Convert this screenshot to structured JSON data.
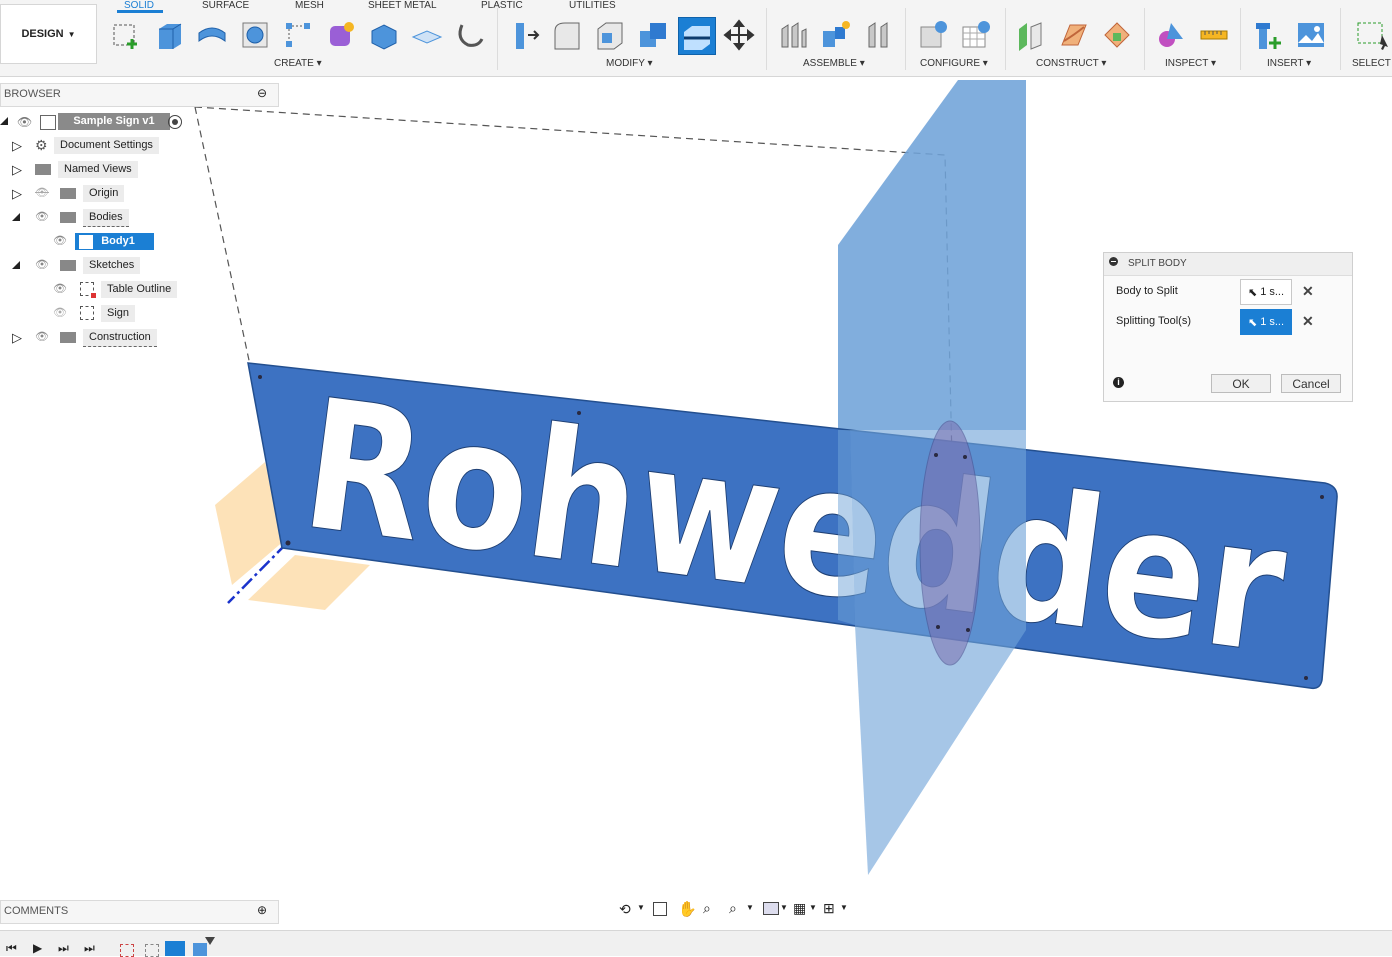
{
  "toolbar": {
    "workspace": "DESIGN",
    "tabs": [
      "SOLID",
      "SURFACE",
      "MESH",
      "SHEET METAL",
      "PLASTIC",
      "UTILITIES"
    ],
    "groups": [
      "CREATE",
      "MODIFY",
      "ASSEMBLE",
      "CONFIGURE",
      "CONSTRUCT",
      "INSPECT",
      "INSERT",
      "SELECT"
    ]
  },
  "browser": {
    "title": "BROWSER",
    "root": "Sample Sign v1",
    "items": [
      "Document Settings",
      "Named Views",
      "Origin",
      "Bodies",
      "Body1",
      "Sketches",
      "Table Outline",
      "Sign",
      "Construction"
    ]
  },
  "viewport": {
    "sign_text": "Rohwedder"
  },
  "dialog": {
    "title": "SPLIT BODY",
    "body_to_split_label": "Body to Split",
    "body_to_split_value": "1 s...",
    "splitting_tools_label": "Splitting Tool(s)",
    "splitting_tools_value": "1 s...",
    "ok": "OK",
    "cancel": "Cancel"
  },
  "comments": {
    "title": "COMMENTS"
  },
  "colors": {
    "accent": "#1b7fd4",
    "sign_body": "#3d72c2",
    "plane": "#7faedd",
    "origin_planes": "#fde0b0"
  }
}
